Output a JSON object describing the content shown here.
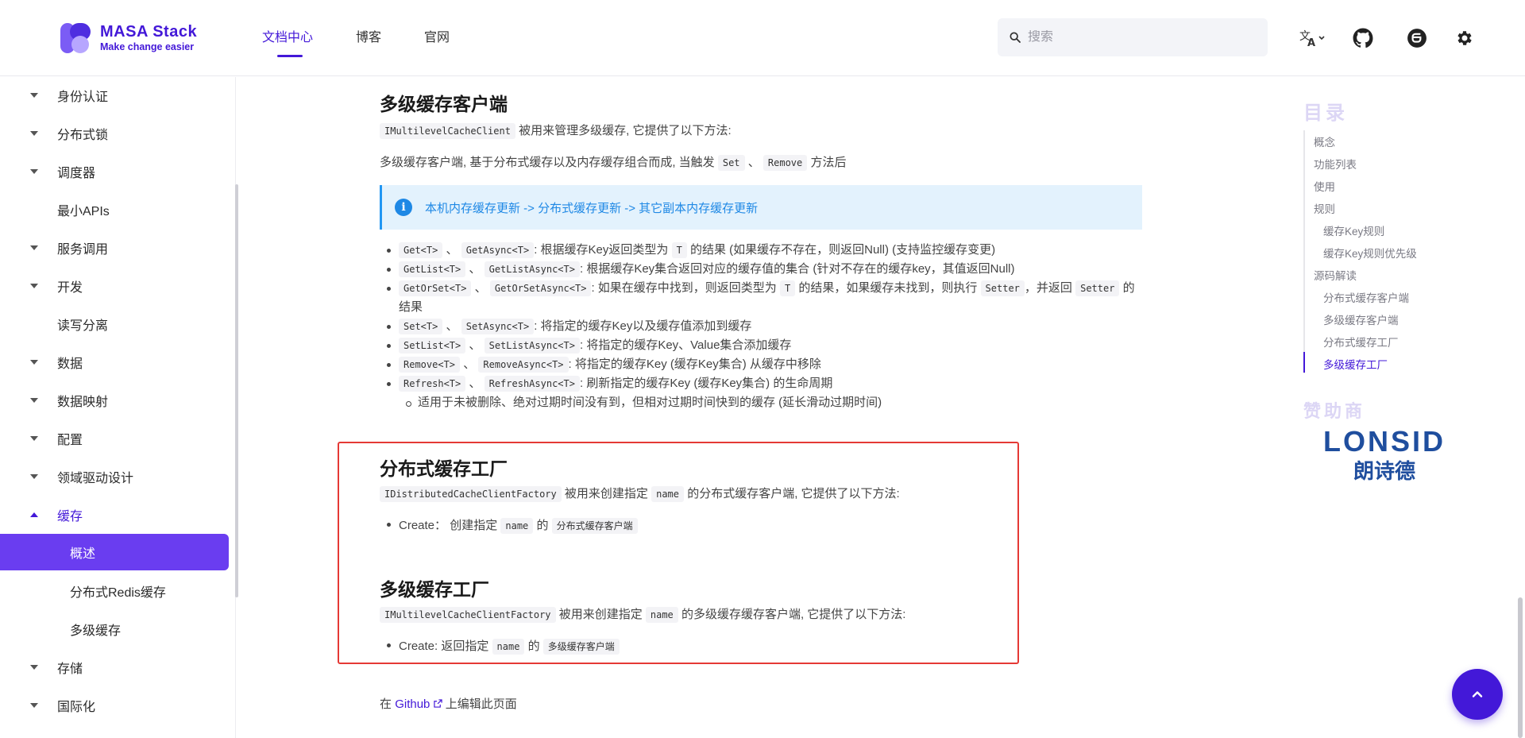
{
  "brand": {
    "title": "MASA Stack",
    "subtitle": "Make change easier"
  },
  "nav": {
    "items": [
      "文档中心",
      "博客",
      "官网"
    ],
    "active": "文档中心"
  },
  "search": {
    "placeholder": "搜索"
  },
  "sidebar": {
    "items": [
      {
        "label": "身份认证",
        "caret": "down"
      },
      {
        "label": "分布式锁",
        "caret": "down"
      },
      {
        "label": "调度器",
        "caret": "down"
      },
      {
        "label": "最小APIs",
        "caret": ""
      },
      {
        "label": "服务调用",
        "caret": "down"
      },
      {
        "label": "开发",
        "caret": "down"
      },
      {
        "label": "读写分离",
        "caret": ""
      },
      {
        "label": "数据",
        "caret": "down"
      },
      {
        "label": "数据映射",
        "caret": "down"
      },
      {
        "label": "配置",
        "caret": "down"
      },
      {
        "label": "领域驱动设计",
        "caret": "down"
      },
      {
        "label": "缓存",
        "caret": "up"
      },
      {
        "label": "概述",
        "caret": ""
      },
      {
        "label": "分布式Redis缓存",
        "caret": ""
      },
      {
        "label": "多级缓存",
        "caret": ""
      },
      {
        "label": "存储",
        "caret": "down"
      },
      {
        "label": "国际化",
        "caret": "down"
      }
    ]
  },
  "content": {
    "multilevel_client": {
      "heading": "多级缓存客户端",
      "intro_code": "IMultilevelCacheClient",
      "intro_text": "被用来管理多级缓存, 它提供了以下方法:",
      "desc_text": "多级缓存客户端, 基于分布式缓存以及内存缓存组合而成, 当触发",
      "desc_code1": "Set",
      "desc_sep": "、",
      "desc_code2": "Remove",
      "desc_tail": "方法后",
      "info": "本机内存缓存更新 -> 分布式缓存更新 -> 其它副本内存缓存更新"
    },
    "methods": [
      {
        "c1": "Get<T>",
        "c2": "GetAsync<T>",
        "t1": ": 根据缓存Key返回类型为",
        "c3": "T",
        "t2": "的结果 (如果缓存不存在，则返回Null) (支持监控缓存变更)"
      },
      {
        "c1": "GetList<T>",
        "c2": "GetListAsync<T>",
        "t1": ": 根据缓存Key集合返回对应的缓存值的集合 (针对不存在的缓存key，其值返回Null)"
      },
      {
        "c1": "GetOrSet<T>",
        "c2": "GetOrSetAsync<T>",
        "t1": ": 如果在缓存中找到，则返回类型为",
        "c3": "T",
        "t2": "的结果，如果缓存未找到，则执行",
        "c4": "Setter",
        "t3": "，并返回",
        "c5": "Setter",
        "t4": "的",
        "t5": "结果"
      },
      {
        "c1": "Set<T>",
        "c2": "SetAsync<T>",
        "t1": ": 将指定的缓存Key以及缓存值添加到缓存"
      },
      {
        "c1": "SetList<T>",
        "c2": "SetListAsync<T>",
        "t1": ": 将指定的缓存Key、Value集合添加缓存"
      },
      {
        "c1": "Remove<T>",
        "c2": "RemoveAsync<T>",
        "t1": ": 将指定的缓存Key (缓存Key集合) 从缓存中移除"
      },
      {
        "c1": "Refresh<T>",
        "c2": "RefreshAsync<T>",
        "t1": ": 刷新指定的缓存Key (缓存Key集合) 的生命周期"
      }
    ],
    "methods_sub": "适用于未被删除、绝对过期时间没有到，但相对过期时间快到的缓存 (延长滑动过期时间)",
    "method_sep": "、",
    "distributed_factory": {
      "heading": "分布式缓存工厂",
      "intro_code": "IDistributedCacheClientFactory",
      "intro_text1": "被用来创建指定",
      "intro_code2": "name",
      "intro_text2": "的分布式缓存客户端, 它提供了以下方法:",
      "bullet_text1": "Create：  创建指定",
      "bullet_code1": "name",
      "bullet_text2": "的",
      "bullet_code2": "分布式缓存客户端"
    },
    "multilevel_factory": {
      "heading": "多级缓存工厂",
      "intro_code": "IMultilevelCacheClientFactory",
      "intro_text1": "被用来创建指定",
      "intro_code2": "name",
      "intro_text2": "的多级缓存缓存客户端, 它提供了以下方法:",
      "bullet_text1": "Create: 返回指定",
      "bullet_code1": "name",
      "bullet_text2": "的",
      "bullet_code2": "多级缓存客户端"
    },
    "edit": {
      "prefix": "在",
      "link": "Github",
      "suffix": "上编辑此页面"
    }
  },
  "toc": {
    "title": "目录",
    "items": [
      {
        "label": "概念",
        "level": 1
      },
      {
        "label": "功能列表",
        "level": 1
      },
      {
        "label": "使用",
        "level": 1
      },
      {
        "label": "规则",
        "level": 1
      },
      {
        "label": "缓存Key规则",
        "level": 2
      },
      {
        "label": "缓存Key规则优先级",
        "level": 2
      },
      {
        "label": "源码解读",
        "level": 1
      },
      {
        "label": "分布式缓存客户端",
        "level": 2
      },
      {
        "label": "多级缓存客户端",
        "level": 2
      },
      {
        "label": "分布式缓存工厂",
        "level": 2
      },
      {
        "label": "多级缓存工厂",
        "level": 2
      }
    ],
    "active": "多级缓存工厂"
  },
  "sponsor": {
    "title": "赞助商",
    "name_en": "LONSID",
    "name_cn": "朗诗德"
  },
  "colors": {
    "brand": "#4318d8",
    "selected_bg": "#6a3df0",
    "info_text": "#1e88e5",
    "highlight_box": "#e53935"
  },
  "icons": [
    "translate-icon",
    "github-icon",
    "gitee-icon",
    "settings-icon",
    "search-icon",
    "info-icon",
    "external-link-icon",
    "arrow-up-icon"
  ]
}
